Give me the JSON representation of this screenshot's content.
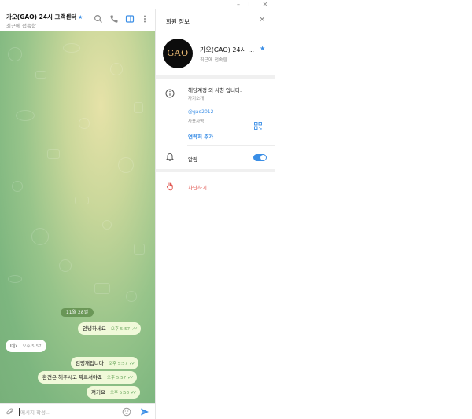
{
  "chat": {
    "title": "가오(GAO) 24시 고객센터",
    "subtitle": "최근에 접속함",
    "date_pill": "11월 28일",
    "messages": [
      {
        "text": "안녕하세요",
        "time": "오후 5:57",
        "out": true
      },
      {
        "text": "네?",
        "time": "오후 5:57",
        "out": false
      },
      {
        "text": "김명재입니다",
        "time": "오후 5:57",
        "out": true
      },
      {
        "text": "환전은 해주시고 짜르셔야죠",
        "time": "오후 5:57",
        "out": true
      },
      {
        "text": "저기요",
        "time": "오후 5:58",
        "out": true
      }
    ],
    "composer_placeholder": "메시지 작성..."
  },
  "panel": {
    "title": "회원 정보",
    "avatar_text": "GAO",
    "name": "가오(GAO) 24시 ...",
    "status": "최근에 접속함",
    "bio": "해당계정 외 사칭 입니다.",
    "bio_label": "자기소개",
    "username": "@gao2012",
    "username_label": "사용자명",
    "add_contact": "연락처 추가",
    "notifications": "알림",
    "notifications_on": true,
    "block": "차단하기"
  },
  "colors": {
    "accent": "#3a8ee6",
    "danger": "#e0524c",
    "outgoing_bubble": "#f0f9d9"
  },
  "icons": [
    "search-icon",
    "phone-icon",
    "sidebar-icon",
    "more-icon",
    "info-icon",
    "qr-icon",
    "bell-icon",
    "hand-icon",
    "paperclip-icon",
    "emoji-icon",
    "send-icon",
    "close-icon",
    "minimize-icon",
    "maximize-icon",
    "star-icon",
    "read-check-icon"
  ]
}
